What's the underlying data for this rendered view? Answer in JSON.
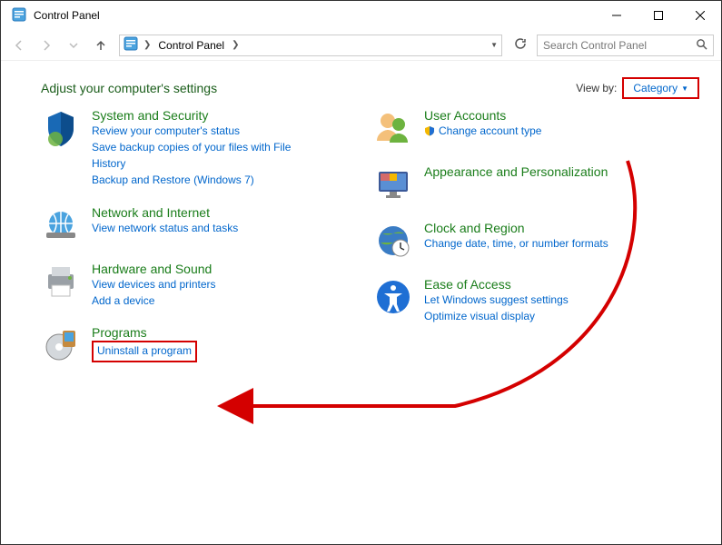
{
  "window": {
    "title": "Control Panel"
  },
  "breadcrumb": {
    "root": "Control Panel"
  },
  "search": {
    "placeholder": "Search Control Panel"
  },
  "heading": "Adjust your computer's settings",
  "viewby": {
    "label": "View by:",
    "value": "Category"
  },
  "categories": {
    "system_security": {
      "title": "System and Security",
      "links": [
        "Review your computer's status",
        "Save backup copies of your files with File History",
        "Backup and Restore (Windows 7)"
      ]
    },
    "network": {
      "title": "Network and Internet",
      "links": [
        "View network status and tasks"
      ]
    },
    "hardware": {
      "title": "Hardware and Sound",
      "links": [
        "View devices and printers",
        "Add a device"
      ]
    },
    "programs": {
      "title": "Programs",
      "links": [
        "Uninstall a program"
      ]
    },
    "user_accounts": {
      "title": "User Accounts",
      "links": [
        "Change account type"
      ]
    },
    "appearance": {
      "title": "Appearance and Personalization"
    },
    "clock": {
      "title": "Clock and Region",
      "links": [
        "Change date, time, or number formats"
      ]
    },
    "ease": {
      "title": "Ease of Access",
      "links": [
        "Let Windows suggest settings",
        "Optimize visual display"
      ]
    }
  }
}
